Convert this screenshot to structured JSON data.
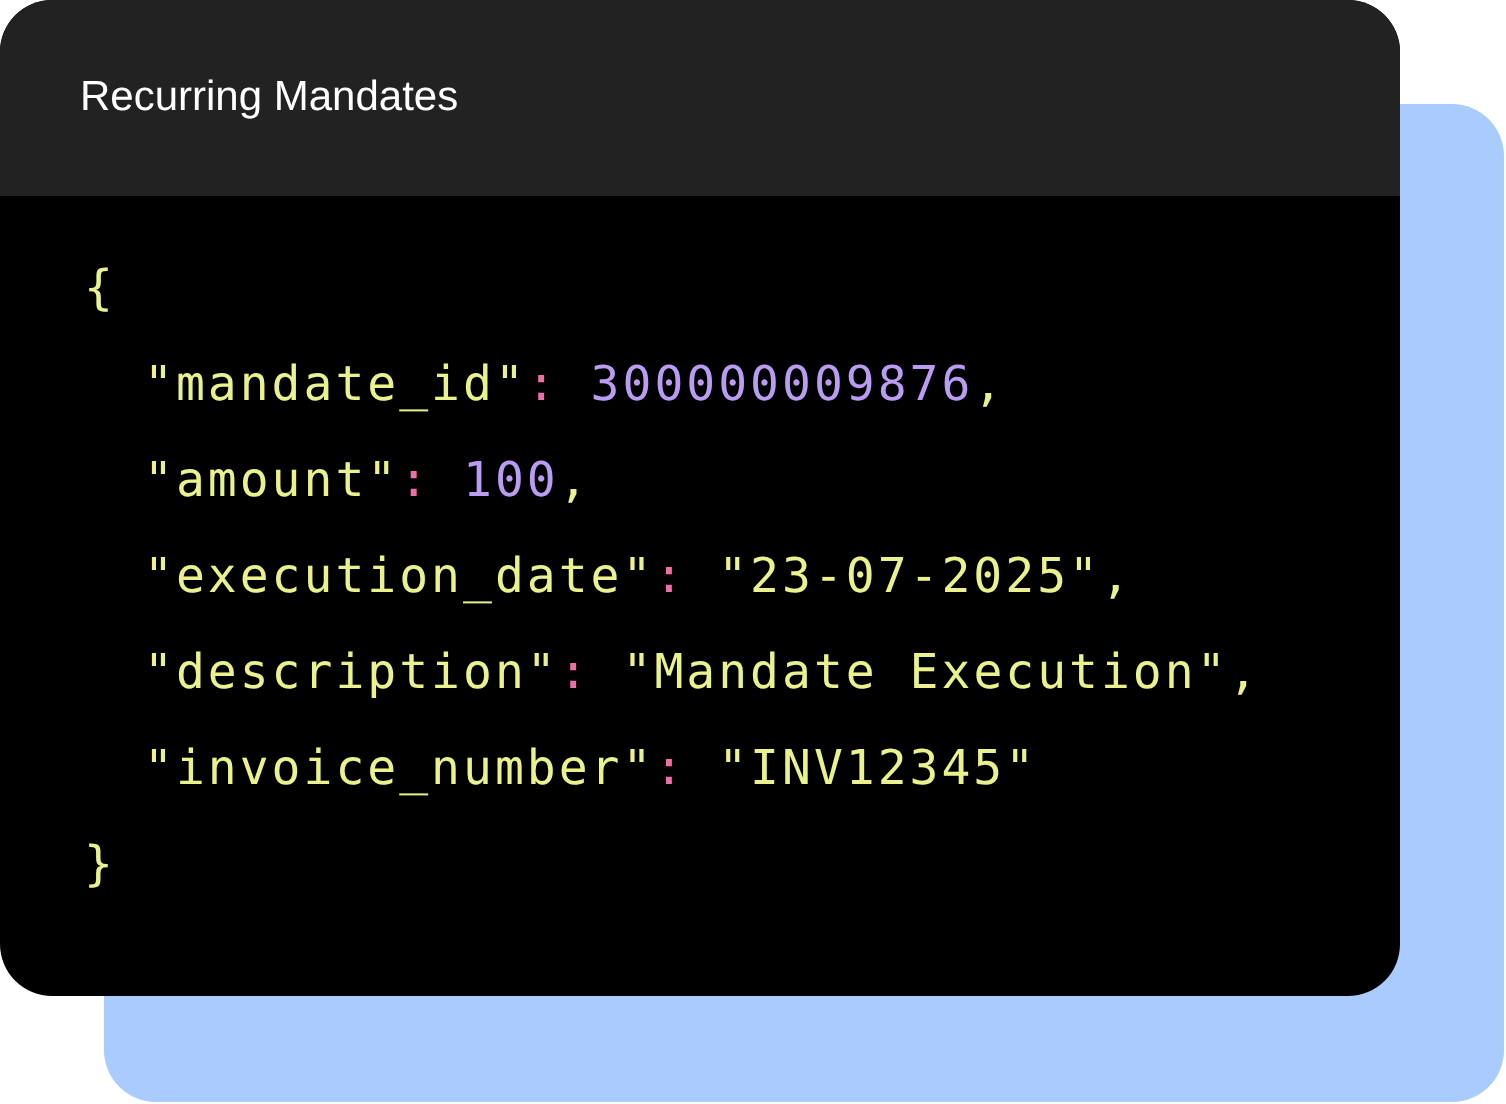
{
  "card": {
    "title": "Recurring Mandates"
  },
  "code": {
    "open": "{",
    "close": "}",
    "children": [
      {
        "tokens": [
          {
            "kind": "key",
            "text": "\"mandate_id\""
          },
          {
            "kind": "colon",
            "text": ":"
          },
          {
            "kind": "number",
            "text": " 300000009876"
          },
          {
            "kind": "punct",
            "text": ","
          }
        ]
      },
      {
        "tokens": [
          {
            "kind": "key",
            "text": "\"amount\""
          },
          {
            "kind": "colon",
            "text": ":"
          },
          {
            "kind": "number",
            "text": " 100"
          },
          {
            "kind": "punct",
            "text": ","
          }
        ]
      },
      {
        "tokens": [
          {
            "kind": "key",
            "text": "\"execution_date\""
          },
          {
            "kind": "colon",
            "text": ":"
          },
          {
            "kind": "string",
            "text": " \"23-07-2025\""
          },
          {
            "kind": "punct",
            "text": ","
          }
        ]
      },
      {
        "tokens": [
          {
            "kind": "key",
            "text": "\"description\""
          },
          {
            "kind": "colon",
            "text": ":"
          },
          {
            "kind": "string",
            "text": " \"Mandate Execution\""
          },
          {
            "kind": "punct",
            "text": ","
          }
        ]
      },
      {
        "tokens": [
          {
            "kind": "key",
            "text": "\"invoice_number\""
          },
          {
            "kind": "colon",
            "text": ":"
          },
          {
            "kind": "string",
            "text": " \"INV12345\""
          }
        ]
      }
    ]
  }
}
